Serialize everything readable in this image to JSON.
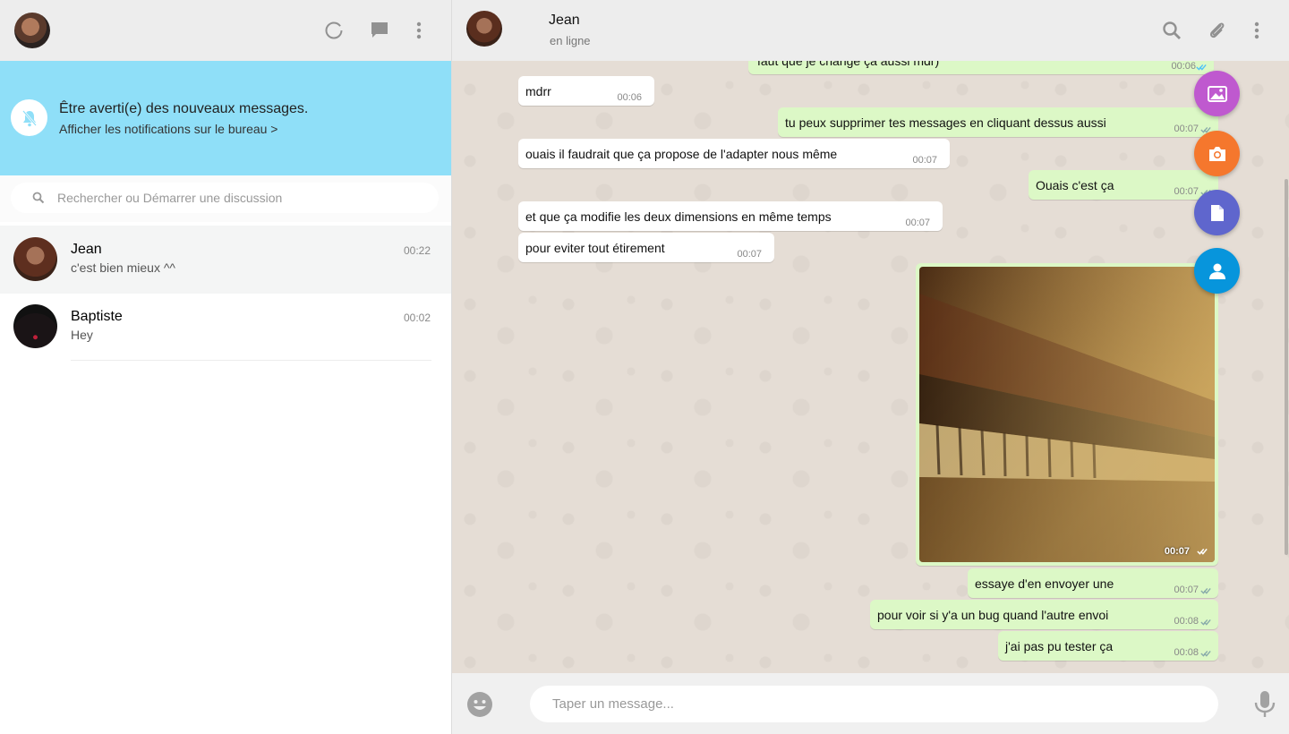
{
  "sidebar": {
    "header": {
      "icons": [
        "status-icon",
        "new-chat-icon",
        "menu-icon"
      ]
    },
    "notification": {
      "title": "Être averti(e) des nouveaux messages.",
      "link": "Afficher les notifications sur le bureau >",
      "icon": "bell-off-icon"
    },
    "search": {
      "placeholder": "Rechercher ou Démarrer une discussion"
    },
    "contacts": [
      {
        "name": "Jean",
        "time": "00:22",
        "last_message": "c'est bien mieux ^^",
        "active": true
      },
      {
        "name": "Baptiste",
        "time": "00:02",
        "last_message": "Hey",
        "active": false
      }
    ]
  },
  "chat": {
    "header": {
      "name": "Jean",
      "status": "en ligne",
      "icons": [
        "search-icon",
        "attach-icon",
        "menu-icon"
      ]
    },
    "messages": [
      {
        "dir": "out",
        "text": "faut que je change ça aussi mdr)",
        "time": "00:06",
        "read": true
      },
      {
        "dir": "in",
        "text": "mdrr",
        "time": "00:06"
      },
      {
        "dir": "out",
        "text": "tu peux supprimer tes messages en cliquant dessus aussi",
        "time": "00:07",
        "read": true
      },
      {
        "dir": "in",
        "text": "ouais il faudrait que ça propose de l'adapter nous même",
        "time": "00:07"
      },
      {
        "dir": "out",
        "text": "Ouais c'est ça",
        "time": "00:07",
        "read": true
      },
      {
        "dir": "in",
        "text": "et que ça modifie les deux dimensions en même temps",
        "time": "00:07"
      },
      {
        "dir": "in",
        "text": "pour eviter tout étirement",
        "time": "00:07"
      },
      {
        "dir": "out",
        "type": "image",
        "image": "piano-keys-photo",
        "time": "00:07",
        "read": true
      },
      {
        "dir": "out",
        "text": "essaye d'en envoyer une",
        "time": "00:07",
        "read": true
      },
      {
        "dir": "out",
        "text": "pour voir si y'a un bug quand l'autre envoi",
        "time": "00:08",
        "read": true
      },
      {
        "dir": "out",
        "text": "j'ai pas pu tester ça",
        "time": "00:08",
        "read": true
      }
    ],
    "attach_menu": [
      {
        "name": "gallery",
        "icon": "image-icon",
        "color": "#bf59cf"
      },
      {
        "name": "camera",
        "icon": "camera-icon",
        "color": "#f5772d"
      },
      {
        "name": "document",
        "icon": "document-icon",
        "color": "#5f66cd"
      },
      {
        "name": "contact",
        "icon": "contact-icon",
        "color": "#0795dc"
      }
    ],
    "composer": {
      "placeholder": "Taper un message...",
      "icons": [
        "emoji-icon",
        "mic-icon"
      ]
    }
  },
  "colors": {
    "notification_bg": "#8fdff8",
    "outgoing_bubble": "#dcf8c6",
    "incoming_bubble": "#ffffff",
    "chat_bg": "#e5ddd5",
    "header_bg": "#ededed"
  }
}
